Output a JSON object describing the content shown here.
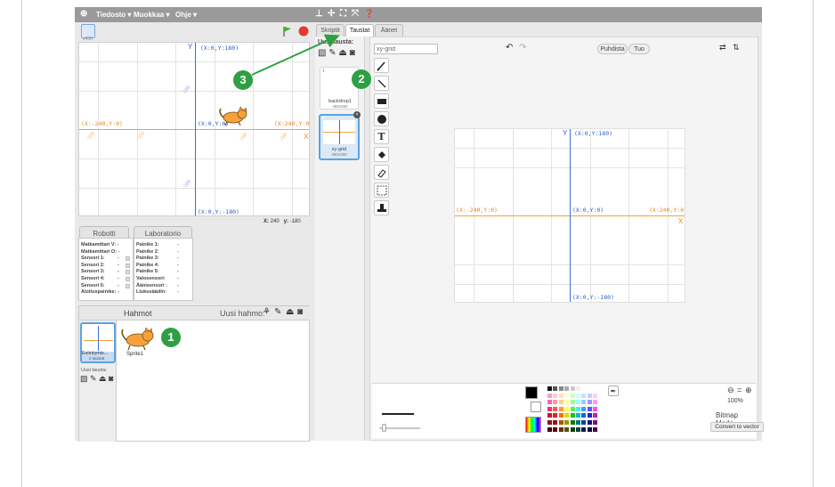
{
  "menu": {
    "file": "Tiedosto ▾",
    "edit": "Muokkaa ▾",
    "help": "Ohje ▾"
  },
  "stage": {
    "version_label": "v435",
    "labels": {
      "top": "(X:0,Y:180)",
      "left": "(X:-240,Y:0)",
      "center": "(X:0,Y:0)",
      "right": "(X:240,Y:0)",
      "bottom": "(X:0,Y:-180)",
      "y_axis": "Y",
      "x_axis": "X",
      "t100": "100",
      "tm100": "-100",
      "tm200": "-200",
      "tm100x": "-100",
      "t100x": "100",
      "t200x": "200",
      "tm100y": "-100"
    },
    "coords": {
      "x_label": "X:",
      "x_value": "240",
      "y_label": "y:",
      "y_value": "-180"
    }
  },
  "robot_panel": {
    "tab_robot": "Robotti",
    "tab_lab": "Laboratorio",
    "robot_rows": [
      "Matkamittari V: -",
      "Matkamittari O: -",
      "Sensori 1:",
      "Sensori 2:",
      "Sensori 3:",
      "Sensori 4:",
      "Sensori 5:",
      "Aloituspainike: -"
    ],
    "lab_rows": [
      "Painike 1:",
      "Painike 2:",
      "Painike 3:",
      "Painike 4:",
      "Painike 5:",
      "Valosensori:",
      "Äänisensori :",
      "Liukusäädin:"
    ],
    "dash": "-"
  },
  "sprites": {
    "header": "Hahmot",
    "new_sprite": "Uusi hahmo:",
    "stage_thumb_label": "Esiintymis...",
    "stage_thumb_sub": "2 taustat",
    "new_backdrop": "Uusi tausta:",
    "sprite1": "Sprite1"
  },
  "tabs": {
    "scripts": "Skriptit",
    "backdrops": "Taustat",
    "sounds": "Äänet"
  },
  "backdrop_list": {
    "new_backdrop": "Uusi tausta:",
    "items": [
      {
        "index": "1",
        "name": "backdrop1",
        "size": "480x360"
      },
      {
        "index": "2",
        "name": "xy-grid",
        "size": "480x360"
      }
    ]
  },
  "editor": {
    "name_value": "xy-grid",
    "clear_button": "Puhdista",
    "import_button": "Tuo",
    "zoom_level": "100%",
    "mode_label": "Bitmap Mode",
    "convert_button": "Convert to vector",
    "canvas_labels": {
      "top": "(X:0,Y:180)",
      "left": "(X:-240,Y:0)",
      "center": "(X:0,Y:0)",
      "right": "(X:240,Y:0)",
      "bottom": "(X:0,Y:-180)",
      "y_axis": "Y",
      "x_axis": "X"
    }
  },
  "annotations": {
    "b1": "1",
    "b2": "2",
    "b3": "3"
  },
  "colors": {
    "accent_green": "#2ea043",
    "axis_orange": "#f2a33a",
    "axis_blue": "#3a6fd8",
    "menubar": "#9a9a9a"
  }
}
